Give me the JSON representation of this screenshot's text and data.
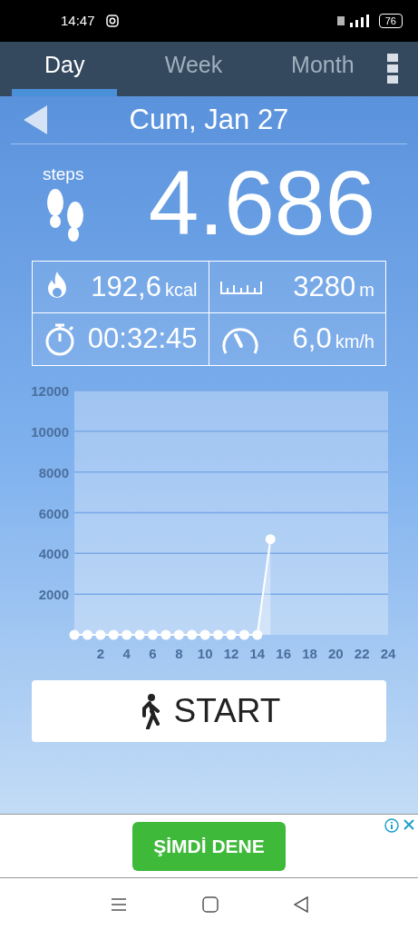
{
  "status_bar": {
    "time": "14:47",
    "battery": "76"
  },
  "tabs": [
    {
      "label": "Day",
      "selected": true
    },
    {
      "label": "Week",
      "selected": false
    },
    {
      "label": "Month",
      "selected": false
    }
  ],
  "date": "Cum, Jan 27",
  "steps": {
    "label": "steps",
    "value": "4.686"
  },
  "stats": [
    {
      "kind": "calories",
      "value": "192,6",
      "unit": "kcal"
    },
    {
      "kind": "distance",
      "value": "3280",
      "unit": "m"
    },
    {
      "kind": "duration",
      "value": "00:32:45"
    },
    {
      "kind": "speed",
      "value": "6,0",
      "unit": "km/h"
    }
  ],
  "chart_data": {
    "type": "area",
    "x": [
      0,
      1,
      2,
      3,
      4,
      5,
      6,
      7,
      8,
      9,
      10,
      11,
      12,
      13,
      14,
      15
    ],
    "series": [
      {
        "color": "#ffffff",
        "values": [
          0,
          0,
          0,
          0,
          0,
          0,
          0,
          0,
          0,
          0,
          0,
          0,
          0,
          0,
          0,
          4700
        ]
      }
    ],
    "grid": true,
    "xlim": [
      0,
      24
    ],
    "ylim": [
      0,
      12000
    ],
    "xticks": [
      2,
      4,
      6,
      8,
      10,
      12,
      14,
      16,
      18,
      20,
      22,
      24
    ],
    "yticks": [
      2000,
      4000,
      6000,
      8000,
      10000,
      12000
    ]
  },
  "start_button": "START",
  "ad": {
    "button": "ŞİMDİ DENE"
  }
}
